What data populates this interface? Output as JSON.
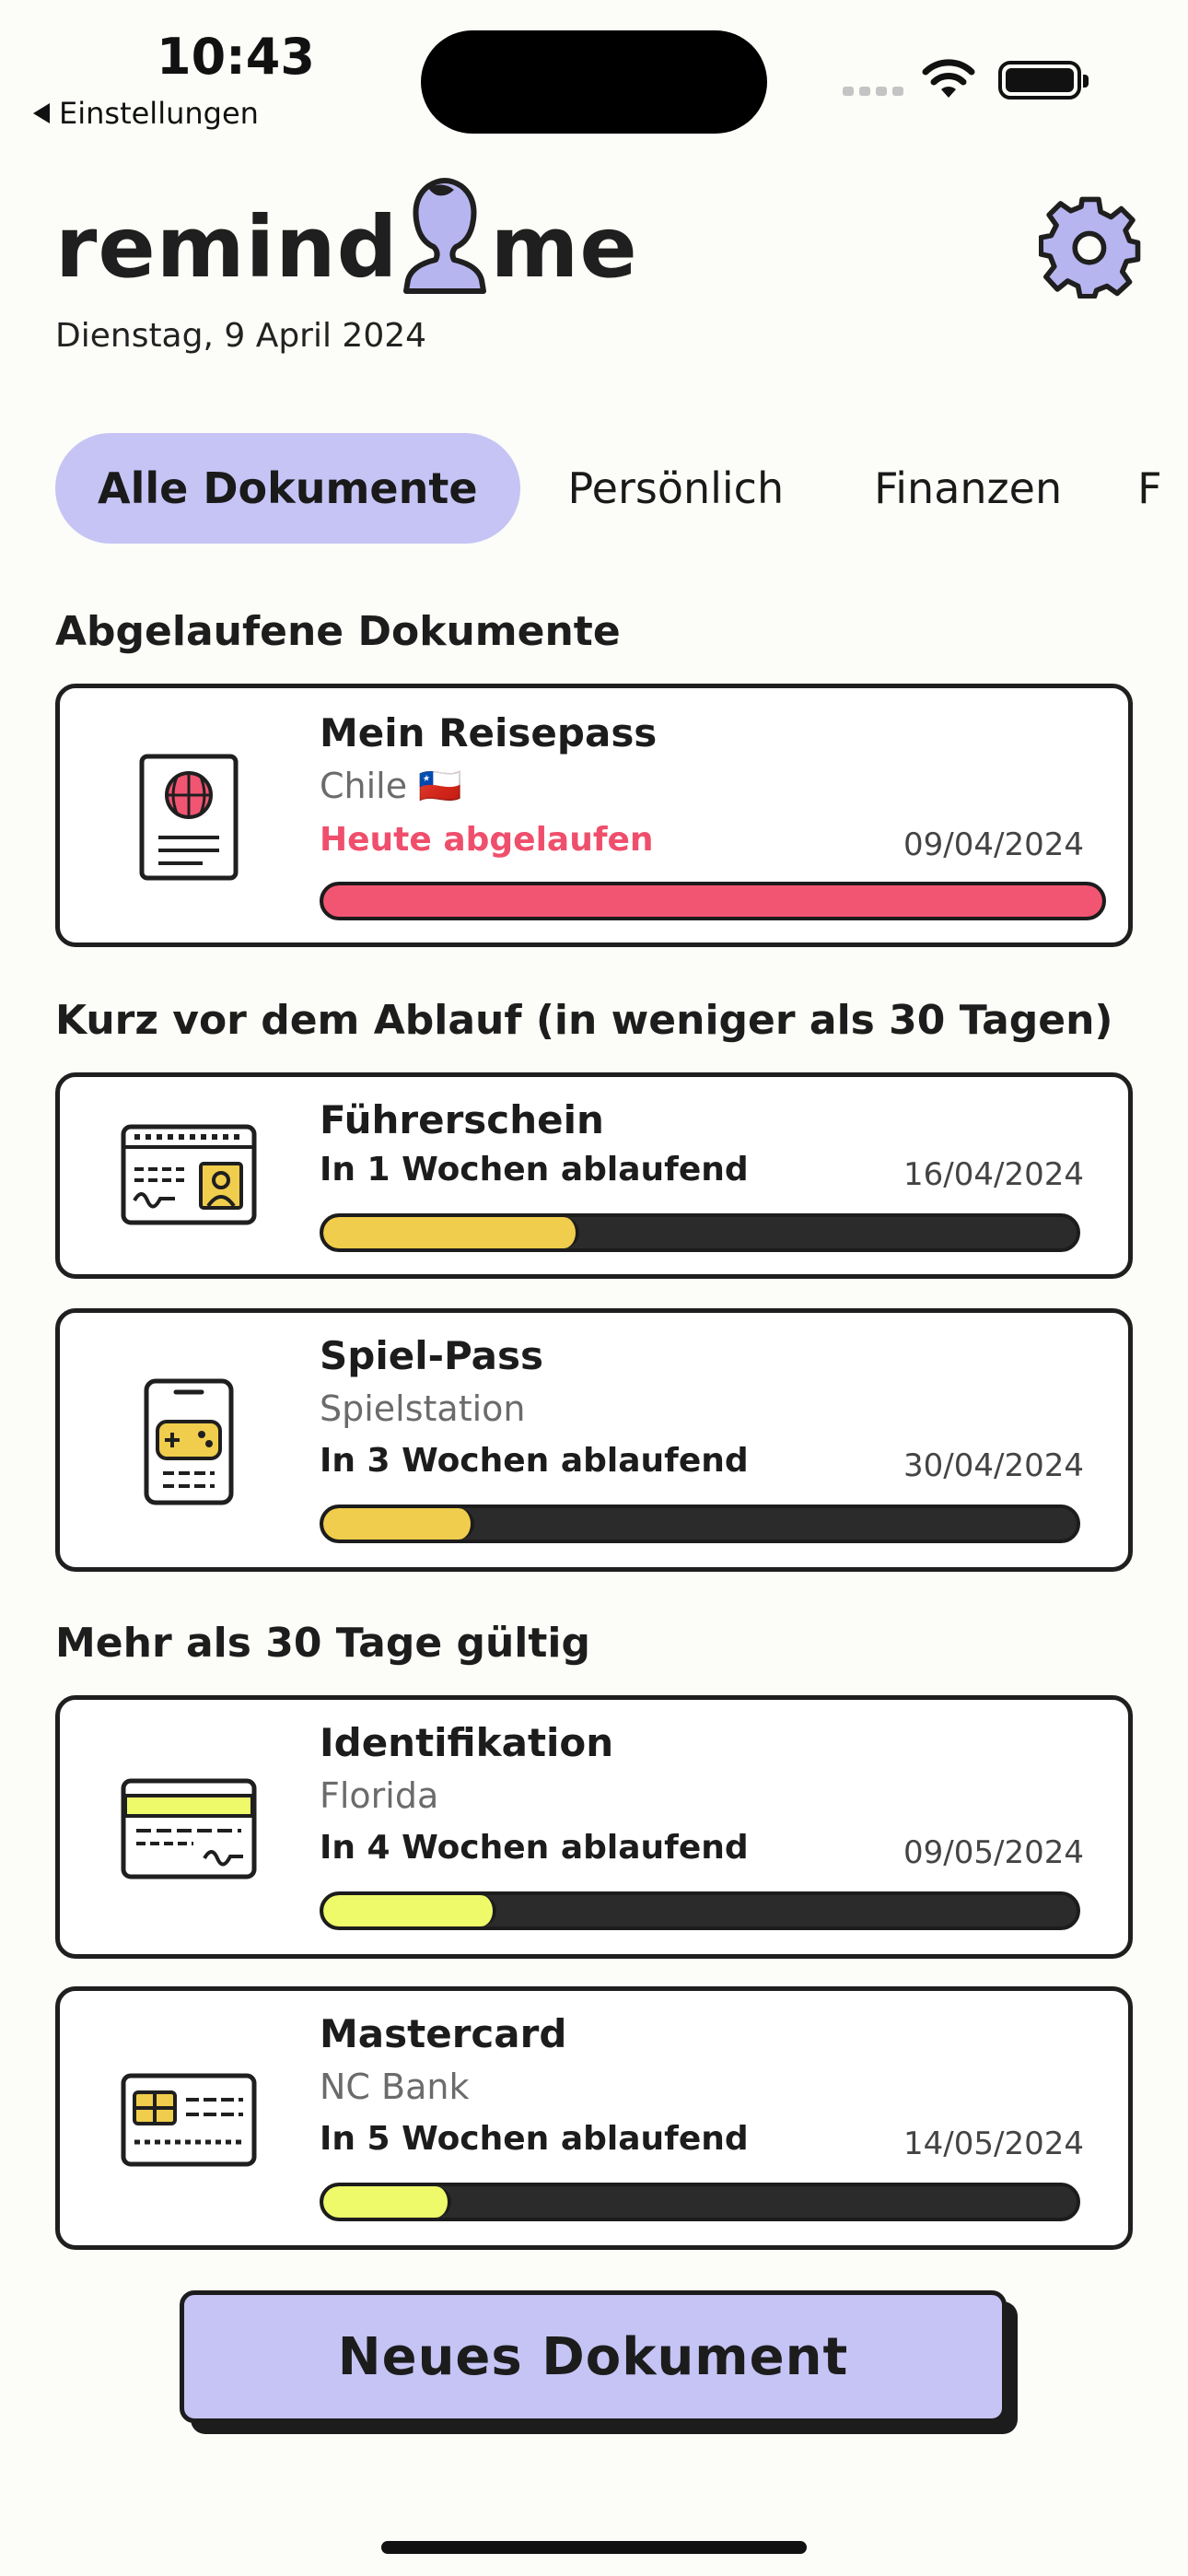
{
  "status_bar": {
    "time": "10:43",
    "back_label": "Einstellungen"
  },
  "header": {
    "logo_left": "remind",
    "logo_right": "me",
    "date": "Dienstag, 9 April 2024"
  },
  "tabs": [
    {
      "label": "Alle Dokumente"
    },
    {
      "label": "Persönlich"
    },
    {
      "label": "Finanzen"
    },
    {
      "label": "F"
    }
  ],
  "sections": {
    "expired": "Abgelaufene Dokumente",
    "soon": "Kurz vor dem Ablauf (in weniger als 30 Tagen)",
    "valid": "Mehr als 30 Tage gültig"
  },
  "documents": [
    {
      "title": "Mein Reisepass",
      "subtitle": "Chile 🇨🇱",
      "status": "Heute abgelaufen",
      "date": "09/04/2024",
      "progress": 1.0,
      "color": "#f25572"
    },
    {
      "title": "Führerschein",
      "subtitle": "",
      "status": "In 1 Wochen ablaufend",
      "date": "16/04/2024",
      "progress": 0.34,
      "color": "#f0cd4c"
    },
    {
      "title": "Spiel-Pass",
      "subtitle": "Spielstation",
      "status": "In 3 Wochen ablaufend",
      "date": "30/04/2024",
      "progress": 0.2,
      "color": "#f0cd4c"
    },
    {
      "title": "Identifikation",
      "subtitle": "Florida",
      "status": "In 4 Wochen ablaufend",
      "date": "09/05/2024",
      "progress": 0.23,
      "color": "#eefa6a"
    },
    {
      "title": "Mastercard",
      "subtitle": "NC Bank",
      "status": "In 5 Wochen ablaufend",
      "date": "14/05/2024",
      "progress": 0.17,
      "color": "#eefa6a"
    }
  ],
  "new_document_label": "Neues Dokument"
}
